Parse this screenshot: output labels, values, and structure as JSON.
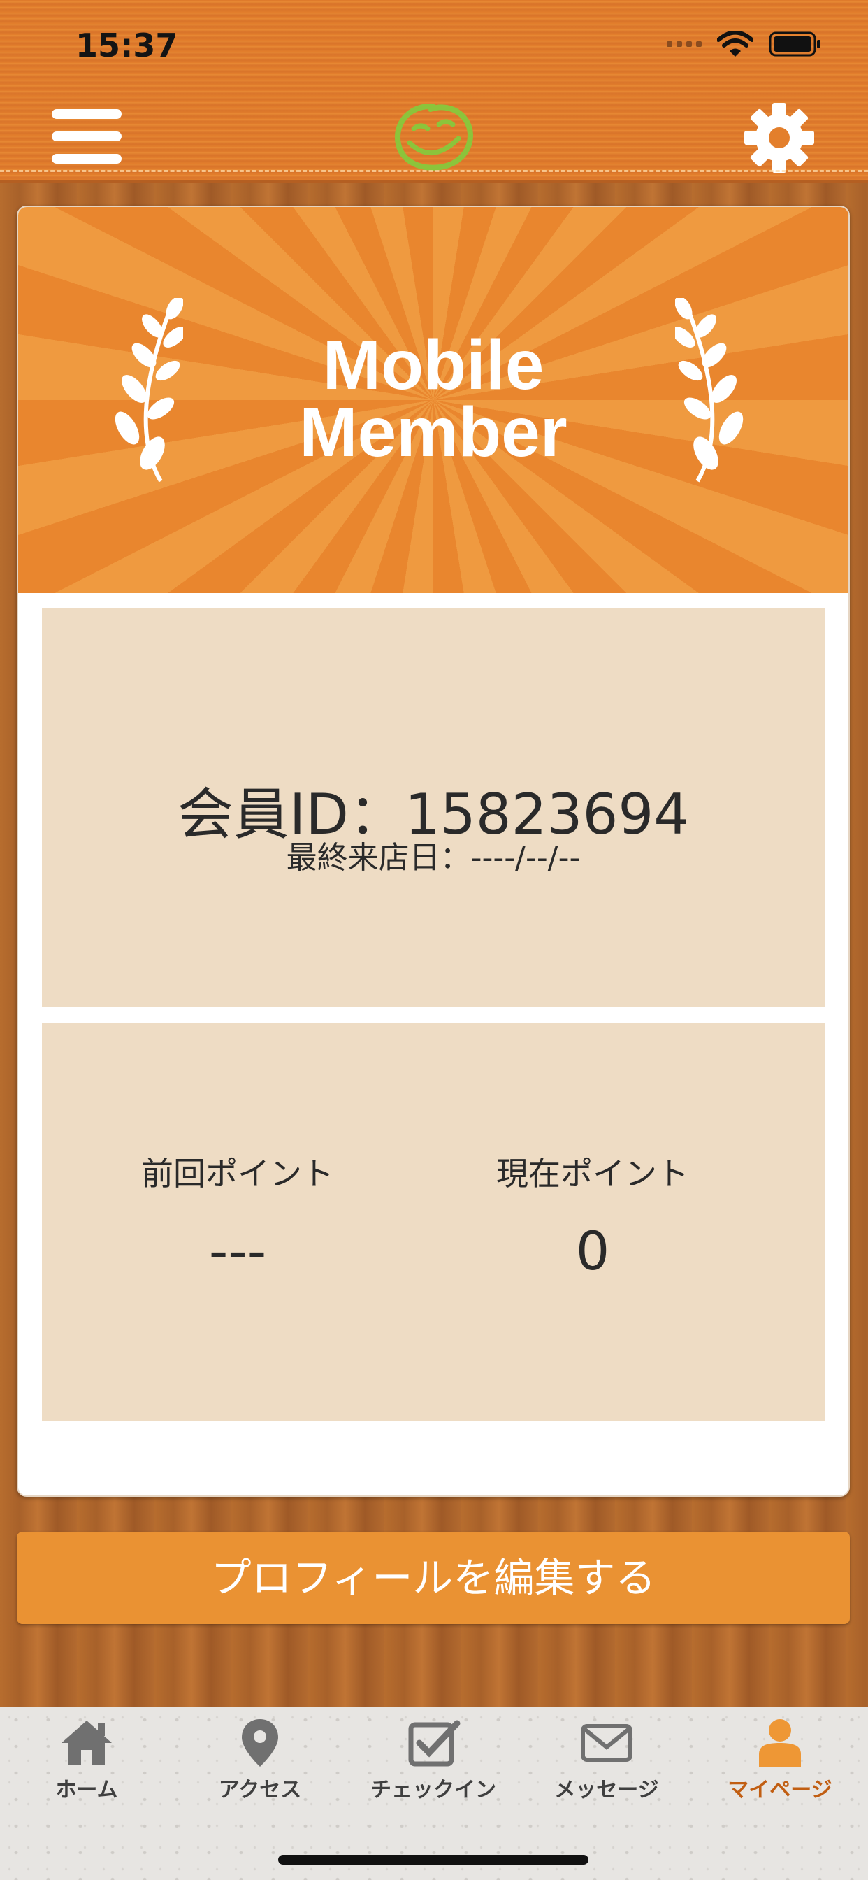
{
  "status_bar": {
    "time": "15:37"
  },
  "banner": {
    "line1": "Mobile",
    "line2": "Member"
  },
  "member": {
    "id_line": "会員ID：15823694",
    "last_visit_line": "最終来店日：----/--/--"
  },
  "points": {
    "previous_label": "前回ポイント",
    "previous_value": "---",
    "current_label": "現在ポイント",
    "current_value": "0"
  },
  "edit_profile_label": "プロフィールを編集する",
  "tabs": [
    {
      "label": "ホーム",
      "icon": "home-icon"
    },
    {
      "label": "アクセス",
      "icon": "map-pin-icon"
    },
    {
      "label": "チェックイン",
      "icon": "checkbox-icon"
    },
    {
      "label": "メッセージ",
      "icon": "envelope-icon"
    },
    {
      "label": "マイページ",
      "icon": "person-icon",
      "active": true
    }
  ],
  "colors": {
    "header": "#e37f2c",
    "accent": "#ea9233",
    "panel": "#eedcc4",
    "active_tab": "#c15e12"
  }
}
